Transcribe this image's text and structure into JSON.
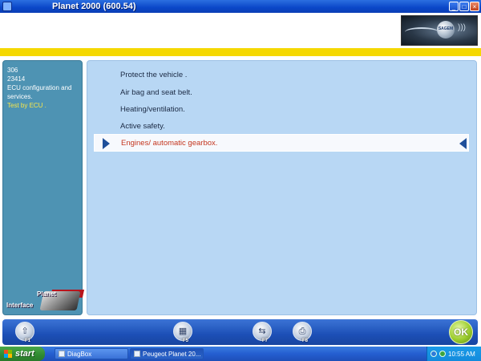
{
  "window": {
    "title": "Planet 2000 (600.54)",
    "buttons": [
      "_",
      "□",
      "×"
    ]
  },
  "logo": {
    "text": "SAGEM"
  },
  "left_panel": {
    "model": "306",
    "code": "23414",
    "section": "ECU configuration and services.",
    "mode": "Test by ECU .",
    "interface_label_1": "Planet",
    "interface_label_2": "Interface"
  },
  "menu": {
    "items": [
      {
        "label": "Protect the vehicle ."
      },
      {
        "label": "Air bag and seat belt."
      },
      {
        "label": "Heating/ventilation."
      },
      {
        "label": "Active safety."
      },
      {
        "label": "Engines/  automatic gearbox.",
        "selected": true
      }
    ]
  },
  "fbar": {
    "keys": [
      {
        "label": "F1",
        "icon": "up-arrow-icon"
      },
      {
        "label": "F5",
        "icon": "ecu-icon"
      },
      {
        "label": "F7",
        "icon": "connector-icon"
      },
      {
        "label": "F8",
        "icon": "printer-icon"
      }
    ],
    "ok": "OK"
  },
  "taskbar": {
    "start": "start",
    "tasks": [
      {
        "label": "DiagBox"
      },
      {
        "label": "Peugeot Planet 20..."
      }
    ],
    "time": "10:55 AM"
  },
  "colors": {
    "accent_blue": "#1c4fb6",
    "menu_bg": "#b8d7f4",
    "left_panel": "#4e93b3",
    "yellow_bar": "#f5d800",
    "selected_text": "#c4361f"
  }
}
